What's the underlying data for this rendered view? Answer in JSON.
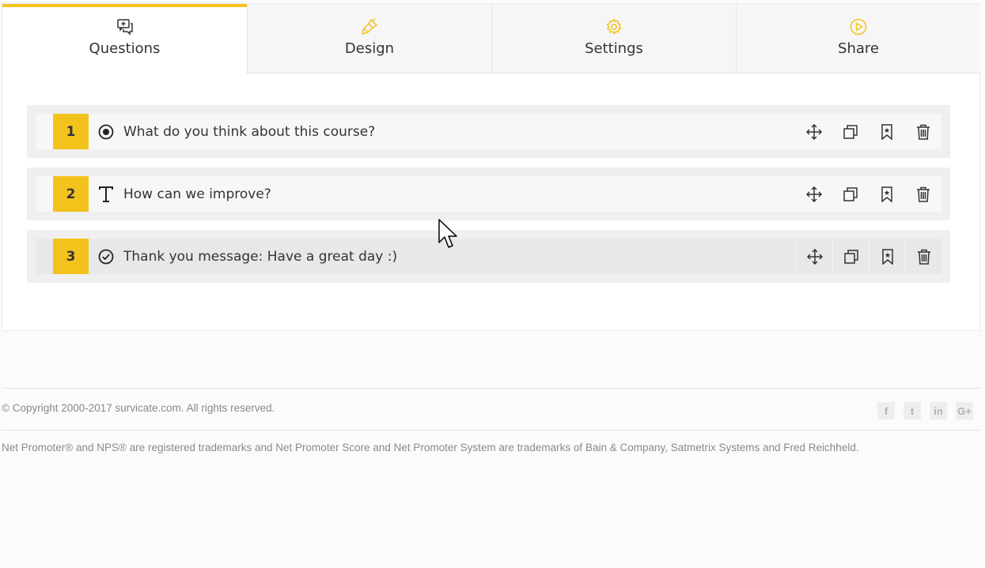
{
  "tabs": [
    {
      "label": "Questions",
      "icon": "questions-icon",
      "active": true
    },
    {
      "label": "Design",
      "icon": "paint-brush-icon",
      "active": false
    },
    {
      "label": "Settings",
      "icon": "gear-icon",
      "active": false
    },
    {
      "label": "Share",
      "icon": "play-circle-icon",
      "active": false
    }
  ],
  "questions": [
    {
      "number": "1",
      "type_icon": "radio-button-icon",
      "text": "What do you think about this course?"
    },
    {
      "number": "2",
      "type_icon": "text-type-icon",
      "text": "How can we improve?"
    },
    {
      "number": "3",
      "type_icon": "check-circle-icon",
      "text": "Thank you message: Have a great day :)"
    }
  ],
  "question_actions": [
    "move-icon",
    "duplicate-icon",
    "bookmark-icon",
    "trash-icon"
  ],
  "footer": {
    "copyright": "© Copyright 2000-2017 survicate.com. All rights reserved.",
    "trademark": "Net Promoter® and NPS® are registered trademarks and Net Promoter Score and Net Promoter System are trademarks of Bain & Company, Satmetrix Systems and Fred Reichheld.",
    "social": [
      {
        "label": "f",
        "icon": "facebook-icon"
      },
      {
        "label": "t",
        "icon": "twitter-icon"
      },
      {
        "label": "in",
        "icon": "linkedin-icon"
      },
      {
        "label": "G+",
        "icon": "google-plus-icon"
      }
    ]
  },
  "colors": {
    "accent": "#f3c31c",
    "text": "#333333",
    "muted": "#8a8a8a"
  }
}
